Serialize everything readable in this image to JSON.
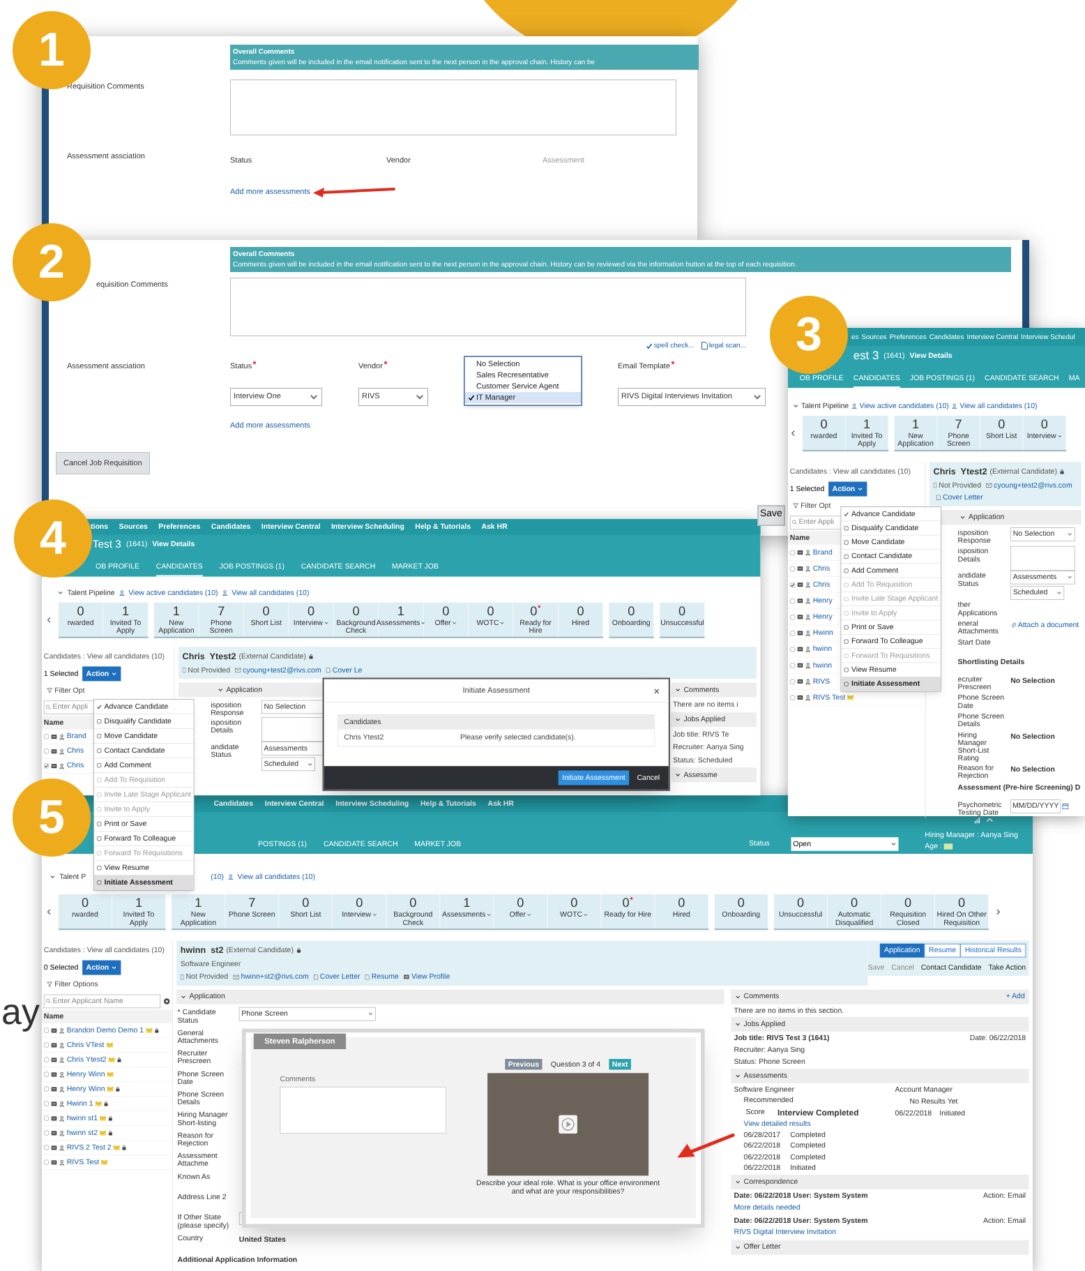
{
  "decor": {
    "partial_word": "ay"
  },
  "step_1": {
    "badge": "1",
    "header_title": "Overall Comments",
    "header_text": "Comments given will be included in the email notification sent to the next person in the approval chain. History can be",
    "comments_label": "Requisition Comments",
    "assessment_label": "Assessment assciation",
    "columns": [
      "Status",
      "Vendor",
      "Assessment"
    ],
    "add_link": "Add more assessments"
  },
  "step_2": {
    "badge": "2",
    "header_title": "Overall Comments",
    "header_text": "Comments given will be included in the email notification sent to the next person in the approval chain. History can be reviewed via the information button at the top of each requisition.",
    "comments_label": "equisition Comments",
    "spell_check": "spell check...",
    "legal_scan": "legal scan...",
    "assessment_label": "Assessment assciation",
    "fields": [
      {
        "kind": "select",
        "label": "Status",
        "required": true,
        "value": "Interview One"
      },
      {
        "kind": "select",
        "label": "Vendor",
        "required": true,
        "value": "RIVS"
      },
      {
        "kind": "list",
        "options": [
          {
            "label": "No Selection",
            "selected": false
          },
          {
            "label": "Sales Recresentative",
            "selected": false
          },
          {
            "label": "Customer Service Agent",
            "selected": false
          },
          {
            "label": "IT Manager",
            "selected": true
          }
        ]
      },
      {
        "kind": "select",
        "label": "Email Template",
        "required": true,
        "value": "RIVS Digital Interviews Invitation"
      }
    ],
    "add_link": "Add more assessments",
    "cancel_button": "Cancel Job Requisition",
    "save_button": "Save"
  },
  "step_3": {
    "badge": "3",
    "nav": [
      "es",
      "Sources",
      "Preferences",
      "Candidates",
      "Interview Central",
      "Interview Schedul"
    ],
    "title": "est 3",
    "req_number": "(1641)",
    "view_details": "View Details",
    "tabs": [
      {
        "label": "OB PROFILE",
        "selected": false
      },
      {
        "label": "CANDIDATES",
        "selected": true
      },
      {
        "label": "JOB POSTINGS (1)",
        "selected": false
      },
      {
        "label": "CANDIDATE SEARCH",
        "selected": false
      },
      {
        "label": "MA",
        "selected": false
      }
    ],
    "pipeline_title": "Talent Pipeline",
    "pipeline_links": [
      "View active candidates (10)",
      "View all candidates (10)"
    ],
    "pipeline": [
      {
        "stages": [
          {
            "count": "0",
            "label": "rwarded",
            "menu": false,
            "flagged": false
          },
          {
            "count": "1",
            "label": "Invited To Apply",
            "menu": false,
            "flagged": false
          }
        ]
      },
      {
        "stages": [
          {
            "count": "1",
            "label": "New Application",
            "menu": false,
            "flagged": false
          },
          {
            "count": "7",
            "label": "Phone Screen",
            "menu": false,
            "flagged": false
          },
          {
            "count": "0",
            "label": "Short List",
            "menu": false,
            "flagged": false
          },
          {
            "count": "0",
            "label": "Interview",
            "menu": true,
            "flagged": false
          }
        ]
      }
    ],
    "candidates_heading": "Candidates : View all candidates (10)",
    "selected_count": "1 Selected",
    "action_button": "Action",
    "filter": "Filter Opt",
    "search_placeholder": "Enter Appli",
    "name_heading": "Name",
    "candidates": [
      {
        "name": "Brand",
        "checked": false,
        "tagged": false
      },
      {
        "name": "Chris",
        "checked": false,
        "tagged": false
      },
      {
        "name": "Chris",
        "checked": true,
        "tagged": false
      },
      {
        "name": "Henry",
        "checked": false,
        "tagged": false
      },
      {
        "name": "Henry",
        "checked": false,
        "tagged": false
      },
      {
        "name": "Hwinn",
        "checked": false,
        "tagged": false
      },
      {
        "name": "hwinn",
        "checked": false,
        "tagged": false
      },
      {
        "name": "hwinn",
        "checked": false,
        "tagged": false
      },
      {
        "name": "RIVS",
        "checked": false,
        "tagged": false
      },
      {
        "name": "RIVS Test",
        "checked": false,
        "tagged": true
      }
    ],
    "menu": [
      {
        "label": "Advance Candidate",
        "disabled": false,
        "highlighted": false
      },
      {
        "label": "Disqualify Candidate",
        "disabled": false,
        "highlighted": false
      },
      {
        "label": "Move Candidate",
        "disabled": false,
        "highlighted": false
      },
      {
        "label": "Contact Candidate",
        "disabled": false,
        "highlighted": false
      },
      {
        "label": "Add Comment",
        "disabled": false,
        "highlighted": false
      },
      {
        "label": "Add To Requisition",
        "disabled": true,
        "highlighted": false
      },
      {
        "label": "Invite Late Stage Applicant",
        "disabled": true,
        "highlighted": false
      },
      {
        "label": "Invite to Apply",
        "disabled": true,
        "highlighted": false
      },
      {
        "label": "Print or Save",
        "disabled": false,
        "highlighted": false
      },
      {
        "label": "Forward To Colleague",
        "disabled": false,
        "highlighted": false
      },
      {
        "label": "Forward To Requisitions",
        "disabled": true,
        "highlighted": false
      },
      {
        "label": "View Resume",
        "disabled": false,
        "highlighted": false
      },
      {
        "label": "Initiate Assessment",
        "disabled": false,
        "highlighted": true
      }
    ],
    "candidate": {
      "name": "Chris  Ytest2",
      "type": "(External Candidate)",
      "phone": "Not Provided",
      "email": "cyoung+test2@rivs.com",
      "cover_letter": "Cover Letter"
    },
    "section": "Application",
    "form": [
      {
        "kind": "select",
        "label": "isposition Response",
        "values": [
          "No Selection"
        ]
      },
      {
        "kind": "textarea",
        "label": "isposition Details"
      },
      {
        "kind": "select",
        "label": "andidate Status",
        "values": [
          "Assessments",
          "Scheduled"
        ]
      },
      {
        "kind": "label",
        "label": "ther Applications"
      },
      {
        "kind": "link",
        "label": "eneral Attachments",
        "value": "Attach a document"
      },
      {
        "kind": "label",
        "label": "Start Date"
      },
      {
        "kind": "heading",
        "value": "Shortlisting Details"
      },
      {
        "kind": "text",
        "label": "ecruiter Prescreen",
        "value": "No Selection"
      },
      {
        "kind": "label",
        "label": "Phone Screen Date"
      },
      {
        "kind": "label",
        "label": "Phone Screen Details"
      },
      {
        "kind": "text",
        "label": "Hiring Manager Short-List Rating",
        "value": "No Selection"
      },
      {
        "kind": "text",
        "label": "Reason for Rejection",
        "value": "No Selection"
      },
      {
        "kind": "heading",
        "value": "Assessment (Pre-hire Screening) D"
      },
      {
        "kind": "date",
        "label": "Psychometric Testing Date",
        "value": "MM/DD/YYYY"
      }
    ]
  },
  "step_4": {
    "badge": "4",
    "nav": [
      "tions",
      "Sources",
      "Preferences",
      "Candidates",
      "Interview Central",
      "Interview Scheduling",
      "Help & Tutorials",
      "Ask HR"
    ],
    "title": "Test 3",
    "req_number": "(1641)",
    "view_details": "View Details",
    "tabs": [
      {
        "label": "OB PROFILE",
        "selected": false
      },
      {
        "label": "CANDIDATES",
        "selected": true
      },
      {
        "label": "JOB POSTINGS (1)",
        "selected": false
      },
      {
        "label": "CANDIDATE SEARCH",
        "selected": false
      },
      {
        "label": "MARKET JOB",
        "selected": false
      }
    ],
    "pipeline_title": "Talent Pipeline",
    "pipeline_links": [
      "View active candidates (10)",
      "View all candidates (10)"
    ],
    "pipeline": [
      {
        "stages": [
          {
            "count": "0",
            "label": "rwarded",
            "menu": false,
            "flagged": false
          },
          {
            "count": "1",
            "label": "Invited To Apply",
            "menu": false,
            "flagged": false
          }
        ]
      },
      {
        "stages": [
          {
            "count": "1",
            "label": "New Application",
            "menu": false,
            "flagged": false
          },
          {
            "count": "7",
            "label": "Phone Screen",
            "menu": false,
            "flagged": false
          },
          {
            "count": "0",
            "label": "Short List",
            "menu": false,
            "flagged": false
          },
          {
            "count": "0",
            "label": "Interview",
            "menu": true,
            "flagged": false
          },
          {
            "count": "0",
            "label": "Background Check",
            "menu": false,
            "flagged": false
          },
          {
            "count": "1",
            "label": "Assessments",
            "menu": true,
            "flagged": false
          },
          {
            "count": "0",
            "label": "Offer",
            "menu": true,
            "flagged": false
          },
          {
            "count": "0",
            "label": "WOTC",
            "menu": true,
            "flagged": false
          },
          {
            "count": "0",
            "label": "Ready for Hire",
            "menu": false,
            "flagged": true
          },
          {
            "count": "0",
            "label": "Hired",
            "menu": false,
            "flagged": false
          }
        ]
      },
      {
        "stages": [
          {
            "count": "0",
            "label": "Onboarding",
            "menu": false,
            "flagged": false
          }
        ]
      },
      {
        "stages": [
          {
            "count": "0",
            "label": "Unsuccessful",
            "menu": false,
            "flagged": false
          }
        ]
      }
    ],
    "candidates_heading": "Candidates : View all candidates (10)",
    "selected_count": "1 Selected",
    "action_button": "Action",
    "filter": "Filter Opt",
    "search_placeholder": "Enter Appli",
    "name_heading": "Name",
    "candidates": [
      {
        "name": "Brand",
        "checked": false,
        "tagged": false
      },
      {
        "name": "Chris",
        "checked": false,
        "tagged": false
      },
      {
        "name": "Chris",
        "checked": true,
        "tagged": false
      }
    ],
    "menu": [
      {
        "label": "Advance Candidate",
        "disabled": false,
        "highlighted": false
      },
      {
        "label": "Disqualify Candidate",
        "disabled": false,
        "highlighted": false
      },
      {
        "label": "Move Candidate",
        "disabled": false,
        "highlighted": false
      },
      {
        "label": "Contact Candidate",
        "disabled": false,
        "highlighted": false
      },
      {
        "label": "Add Comment",
        "disabled": false,
        "highlighted": false
      },
      {
        "label": "Add To Requisition",
        "disabled": true,
        "highlighted": false
      },
      {
        "label": "Invite Late Stage Applicant",
        "disabled": true,
        "highlighted": false
      },
      {
        "label": "Invite to Apply",
        "disabled": true,
        "highlighted": false
      },
      {
        "label": "Print or Save",
        "disabled": false,
        "highlighted": false
      },
      {
        "label": "Forward To Colleague",
        "disabled": false,
        "highlighted": false
      },
      {
        "label": "Forward To Requisitions",
        "disabled": true,
        "highlighted": false
      },
      {
        "label": "View Resume",
        "disabled": false,
        "highlighted": false
      },
      {
        "label": "Initiate Assessment",
        "disabled": false,
        "highlighted": true
      }
    ],
    "candidate": {
      "name": "Chris  Ytest2",
      "type": "(External Candidate)",
      "phone": "Not Provided",
      "email": "cyoung+test2@rivs.com",
      "cover_letter": "Cover Le"
    },
    "section": "Application",
    "form": [
      {
        "kind": "select",
        "label": "isposition Response",
        "values": [
          "No Selection"
        ]
      },
      {
        "kind": "textarea",
        "label": "isposition Details"
      },
      {
        "kind": "select",
        "label": "andidate Status",
        "values": [
          "Assessments",
          "Scheduled"
        ]
      }
    ],
    "side": [
      {
        "title": "Comments",
        "lines": [
          "There are no items i"
        ]
      },
      {
        "title": "Jobs Applied",
        "lines": [
          "Job title: RIVS Te",
          "Recruiter: Aanya Sing",
          "Status: Scheduled"
        ]
      },
      {
        "title": "Assessme"
      }
    ],
    "modal": {
      "title": "Initiate Assessment",
      "close": "×",
      "table_heading": "Candidates",
      "row_name": "Chris Ytest2",
      "message": "Please verify selected candidate(s).",
      "primary_button": "Initiate Assessment",
      "cancel_button": "Cancel"
    }
  },
  "step_5": {
    "badge": "5",
    "nav": [
      "Candidates",
      "Interview Central",
      "Interview Scheduling",
      "Help & Tutorials",
      "Ask HR"
    ],
    "tabs": [
      {
        "label": "POSTINGS (1)",
        "selected": false
      },
      {
        "label": "CANDIDATE SEARCH",
        "selected": false
      },
      {
        "label": "MARKET JOB",
        "selected": false
      }
    ],
    "status_label": "Status",
    "status_value": "Open",
    "hiring_manager": "Hiring Manager : Aanya Sing",
    "age_label": "Age :",
    "pipeline_title": "Talent P",
    "pipeline_links": [
      "(10)",
      "View all candidates (10)"
    ],
    "pipeline": [
      {
        "stages": [
          {
            "count": "0",
            "label": "rwarded",
            "menu": false,
            "flagged": false
          },
          {
            "count": "1",
            "label": "Invited To Apply",
            "menu": false,
            "flagged": false
          }
        ]
      },
      {
        "stages": [
          {
            "count": "1",
            "label": "New Application",
            "menu": false,
            "flagged": false
          },
          {
            "count": "7",
            "label": "Phone Screen",
            "menu": false,
            "flagged": false
          },
          {
            "count": "0",
            "label": "Short List",
            "menu": false,
            "flagged": false
          },
          {
            "count": "0",
            "label": "Interview",
            "menu": true,
            "flagged": false
          },
          {
            "count": "0",
            "label": "Background Check",
            "menu": false,
            "flagged": false
          },
          {
            "count": "1",
            "label": "Assessments",
            "menu": true,
            "flagged": false
          },
          {
            "count": "0",
            "label": "Offer",
            "menu": true,
            "flagged": false
          },
          {
            "count": "0",
            "label": "WOTC",
            "menu": true,
            "flagged": false
          },
          {
            "count": "0",
            "label": "Ready for Hire",
            "menu": false,
            "flagged": true
          },
          {
            "count": "0",
            "label": "Hired",
            "menu": false,
            "flagged": false
          }
        ]
      },
      {
        "stages": [
          {
            "count": "0",
            "label": "Onboarding",
            "menu": false,
            "flagged": false
          }
        ]
      },
      {
        "stages": [
          {
            "count": "0",
            "label": "Unsuccessful",
            "menu": false,
            "flagged": false
          },
          {
            "count": "0",
            "label": "Automatic Disqualified",
            "menu": false,
            "flagged": false
          },
          {
            "count": "0",
            "label": "Requisition Closed",
            "menu": false,
            "flagged": false
          },
          {
            "count": "0",
            "label": "Hired On Other Requisition",
            "menu": false,
            "flagged": false
          }
        ]
      }
    ],
    "candidates_heading": "Candidates : View all candidates (10)",
    "selected_count": "0 Selected",
    "action_button": "Action",
    "filter": "Filter Options",
    "search_placeholder": "Enter Applicant Name",
    "name_heading": "Name",
    "candidates": [
      {
        "name": "Brandon Demo Demo 1",
        "checked": false,
        "tagged": true,
        "locked": true
      },
      {
        "name": "Chris VTest",
        "checked": false,
        "tagged": true,
        "locked": false
      },
      {
        "name": "Chris Ytest2",
        "checked": false,
        "tagged": true,
        "locked": true
      },
      {
        "name": "Henry Winn",
        "checked": false,
        "tagged": true,
        "locked": false
      },
      {
        "name": "Henry Winn",
        "checked": false,
        "tagged": true,
        "locked": true
      },
      {
        "name": "Hwinn 1",
        "checked": false,
        "tagged": true,
        "locked": true
      },
      {
        "name": "hwinn st1",
        "checked": false,
        "tagged": true,
        "locked": true
      },
      {
        "name": "hwinn st2",
        "checked": false,
        "tagged": true,
        "locked": true
      },
      {
        "name": "RIVS 2 Test 2",
        "checked": false,
        "tagged": true,
        "locked": true
      },
      {
        "name": "RIVS Test",
        "checked": false,
        "tagged": true,
        "locked": false
      }
    ],
    "candidate": {
      "name": "hwinn  st2",
      "type": "(External Candidate)",
      "role": "Software Engineer",
      "phone": "Not Provided",
      "email": "hwinn+st2@rivs.com",
      "cover_letter": "Cover Letter",
      "resume": "Resume",
      "profile": "View Profile"
    },
    "detail_tabs": [
      {
        "label": "Application",
        "selected": true
      },
      {
        "label": "Resume",
        "selected": false
      },
      {
        "label": "Historical Results",
        "selected": false
      }
    ],
    "actions": [
      {
        "label": "Save",
        "disabled": true
      },
      {
        "label": "Cancel",
        "disabled": true
      },
      {
        "label": "Contact Candidate",
        "disabled": false
      },
      {
        "label": "Take Action",
        "disabled": false
      }
    ],
    "section": "Application",
    "form": [
      {
        "kind": "select",
        "label": "* Candidate Status",
        "values": [
          "Phone Screen"
        ]
      },
      {
        "kind": "label",
        "label": "General Attachments"
      },
      {
        "kind": "label",
        "label": "Recruiter Prescreen"
      },
      {
        "kind": "label",
        "label": "Phone Screen Date"
      },
      {
        "kind": "label",
        "label": "Phone Screen Details"
      },
      {
        "kind": "label",
        "label": "Hiring Manager Short-listing"
      },
      {
        "kind": "label",
        "label": "Reason for Rejection"
      },
      {
        "kind": "label",
        "label": "Assessment Attachme"
      },
      {
        "kind": "label",
        "label": "Known As"
      },
      {
        "kind": "label",
        "label": "Address Line 2"
      },
      {
        "kind": "input",
        "label": "If Other State (please specify)"
      },
      {
        "kind": "text",
        "label": "Country",
        "value": "United States"
      },
      {
        "kind": "heading",
        "value": "Additional Application Information"
      }
    ],
    "video": {
      "name": "Steven Ralpherson",
      "comments_label": "Comments",
      "previous": "Previous",
      "question": "Question 3 of 4",
      "next": "Next",
      "caption": "Describe your ideal role. What is your office environment and what are your responsibilities?"
    },
    "comments": {
      "title": "Comments",
      "add": "+ Add",
      "empty": "There are no items in this section."
    },
    "jobs": {
      "title": "Jobs Applied",
      "job": "Job title: RIVS Test 3 (1641)",
      "date": "Date: 06/22/2018",
      "recruiter": "Recruiter: Aanya Sing",
      "status": "Status: Phone Screen"
    },
    "assessments": {
      "title": "Assessments",
      "role": "Software Engineer",
      "recommendation": "Recommended",
      "score_label": "Score",
      "result": "Interview Completed",
      "link": "View detailed results",
      "history": [
        [
          "06/28/2017",
          "Completed"
        ],
        [
          "06/22/2018",
          "Completed"
        ],
        [
          "06/22/2018",
          "Completed"
        ],
        [
          "06/22/2018",
          "Initiated"
        ]
      ],
      "other_role": "Account Manager",
      "other_result": "No Results Yet",
      "other_history": [
        [
          "06/22/2018",
          "Initiated"
        ]
      ]
    },
    "correspondence": {
      "title": "Correspondence",
      "entries": [
        {
          "meta": "Date: 06/22/2018 User: System System",
          "subject": "More details needed",
          "action": "Action: Email"
        },
        {
          "meta": "Date: 06/22/2018 User: System System",
          "subject": "RIVS Digital Interview Invitation",
          "action": "Action: Email"
        }
      ]
    },
    "offer_letter": {
      "title": "Offer Letter"
    }
  }
}
